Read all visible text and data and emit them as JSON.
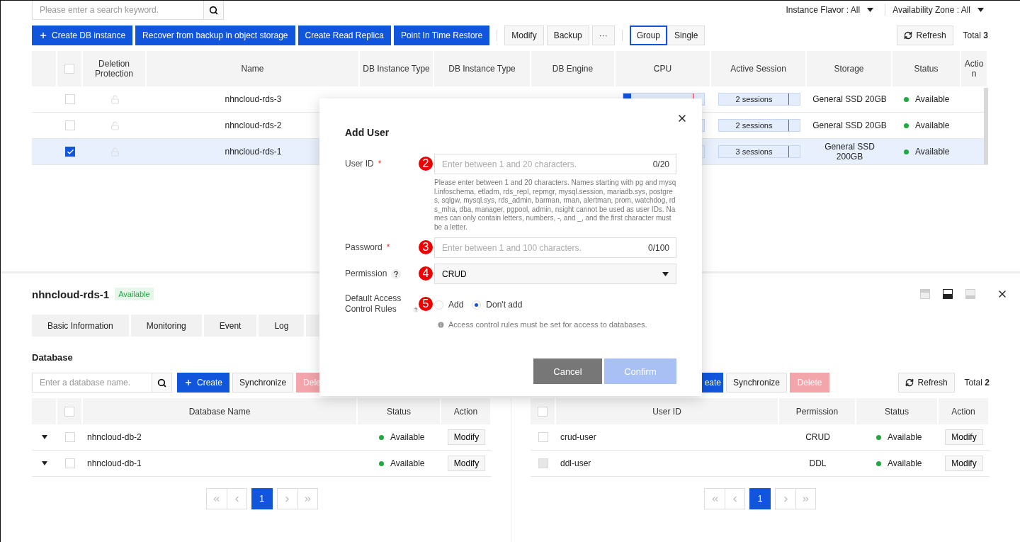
{
  "filters": {
    "search_placeholder": "Please enter a search keyword.",
    "instance_flavor": "Instance Flavor : All",
    "availability_zone": "Availability Zone : All"
  },
  "toolbar": {
    "primary": [
      {
        "label": "Create DB instance",
        "kind": "add"
      },
      {
        "label": "Recover from backup in object storage",
        "kind": "plain"
      },
      {
        "label": "Create Read Replica",
        "kind": "plain"
      },
      {
        "label": "Point In Time Restore",
        "kind": "plain"
      }
    ],
    "secondary": [
      "Modify",
      "Backup",
      "···"
    ],
    "view_toggle": [
      {
        "label": "Group",
        "selected": true
      },
      {
        "label": "Single",
        "selected": false
      }
    ],
    "refresh": "Refresh",
    "total_label": "Total",
    "total": "3"
  },
  "instances": {
    "select_all": false,
    "columns": [
      "Deletion Protection",
      "Name",
      "DB Instance Type",
      "DB Instance Type",
      "DB Engine",
      "CPU",
      "Active Session",
      "Storage",
      "Status",
      "Action"
    ],
    "rows": [
      {
        "name": "nhncloud-rds-3",
        "checked": false,
        "selected": false,
        "cpu": {
          "level": 0.1
        },
        "session": "2 sessions",
        "storage": "General SSD 20GB",
        "status": "Available"
      },
      {
        "name": "nhncloud-rds-2",
        "checked": false,
        "selected": false,
        "session": "2 sessions",
        "storage": "General SSD 20GB",
        "status": "Available"
      },
      {
        "name": "nhncloud-rds-1",
        "checked": true,
        "selected": true,
        "session": "3 sessions",
        "storage": "General SSD 200GB",
        "status": "Available"
      }
    ]
  },
  "detail": {
    "title": "nhncloud-rds-1",
    "badge": "Available",
    "layouts": [
      {
        "kind": "top",
        "selected": false
      },
      {
        "kind": "middle",
        "selected": true
      },
      {
        "kind": "bottom",
        "selected": false
      }
    ],
    "tabs": [
      {
        "label": "Basic Information",
        "selected": false
      },
      {
        "label": "Monitoring",
        "selected": false
      },
      {
        "label": "Event",
        "selected": false
      },
      {
        "label": "Log",
        "selected": false
      }
    ],
    "database": {
      "heading": "Database",
      "search_placeholder": "Enter a database name.",
      "create": "Create",
      "synchronize": "Synchronize",
      "delete": "Dele",
      "select_all": false,
      "columns": [
        "Database Name",
        "Status",
        "Action"
      ],
      "rows": [
        {
          "name": "nhncloud-db-2",
          "checked": false,
          "status": "Available",
          "action": "Modify"
        },
        {
          "name": "nhncloud-db-1",
          "checked": false,
          "status": "Available",
          "action": "Modify"
        }
      ],
      "page": "1"
    },
    "users": {
      "create": "eate",
      "synchronize": "Synchronize",
      "delete": "Delete",
      "refresh": "Refresh",
      "total_label": "Total",
      "total": "2",
      "select_all": false,
      "columns": [
        "User ID",
        "Permission",
        "Status",
        "Action"
      ],
      "rows": [
        {
          "user_id": "crud-user",
          "permission": "CRUD",
          "status": "Available",
          "action": "Modify",
          "disabled": false
        },
        {
          "user_id": "ddl-user",
          "permission": "DDL",
          "status": "Available",
          "action": "Modify",
          "disabled": true
        }
      ],
      "page": "1"
    }
  },
  "modal": {
    "title": "Add User",
    "user_id": {
      "label": "User ID",
      "required_mark": "*",
      "step": "2",
      "placeholder": "Enter between 1 and 20 characters.",
      "counter": "0/20",
      "help": "Please enter between 1 and 20 characters. Names starting with pg and mysql.infoschema, etladm, rds_repl, repmgr, mysql.session, mariadb.sys, postgres, sqlgw, mysql.sys, rds_admin, barman, rman, alertman, prom, watchdog, rds_mha, dba, manager, pgpool, admin, nsight cannot be used as user IDs. Names can only contain letters, numbers, -, and _, and the first character must be a letter."
    },
    "password": {
      "label": "Password",
      "required_mark": "*",
      "step": "3",
      "placeholder": "Enter between 1 and 100 characters.",
      "counter": "0/100"
    },
    "permission": {
      "label": "Permission",
      "step": "4",
      "value": "CRUD"
    },
    "access_rules": {
      "label": "Default Access Control Rules",
      "step": "5",
      "options": [
        {
          "label": "Add",
          "selected": false
        },
        {
          "label": "Don't add",
          "selected": true
        }
      ],
      "note": "Access control rules must be set for access to databases."
    },
    "buttons": {
      "cancel": "Cancel",
      "confirm": "Confirm",
      "confirm_disabled": true
    }
  }
}
